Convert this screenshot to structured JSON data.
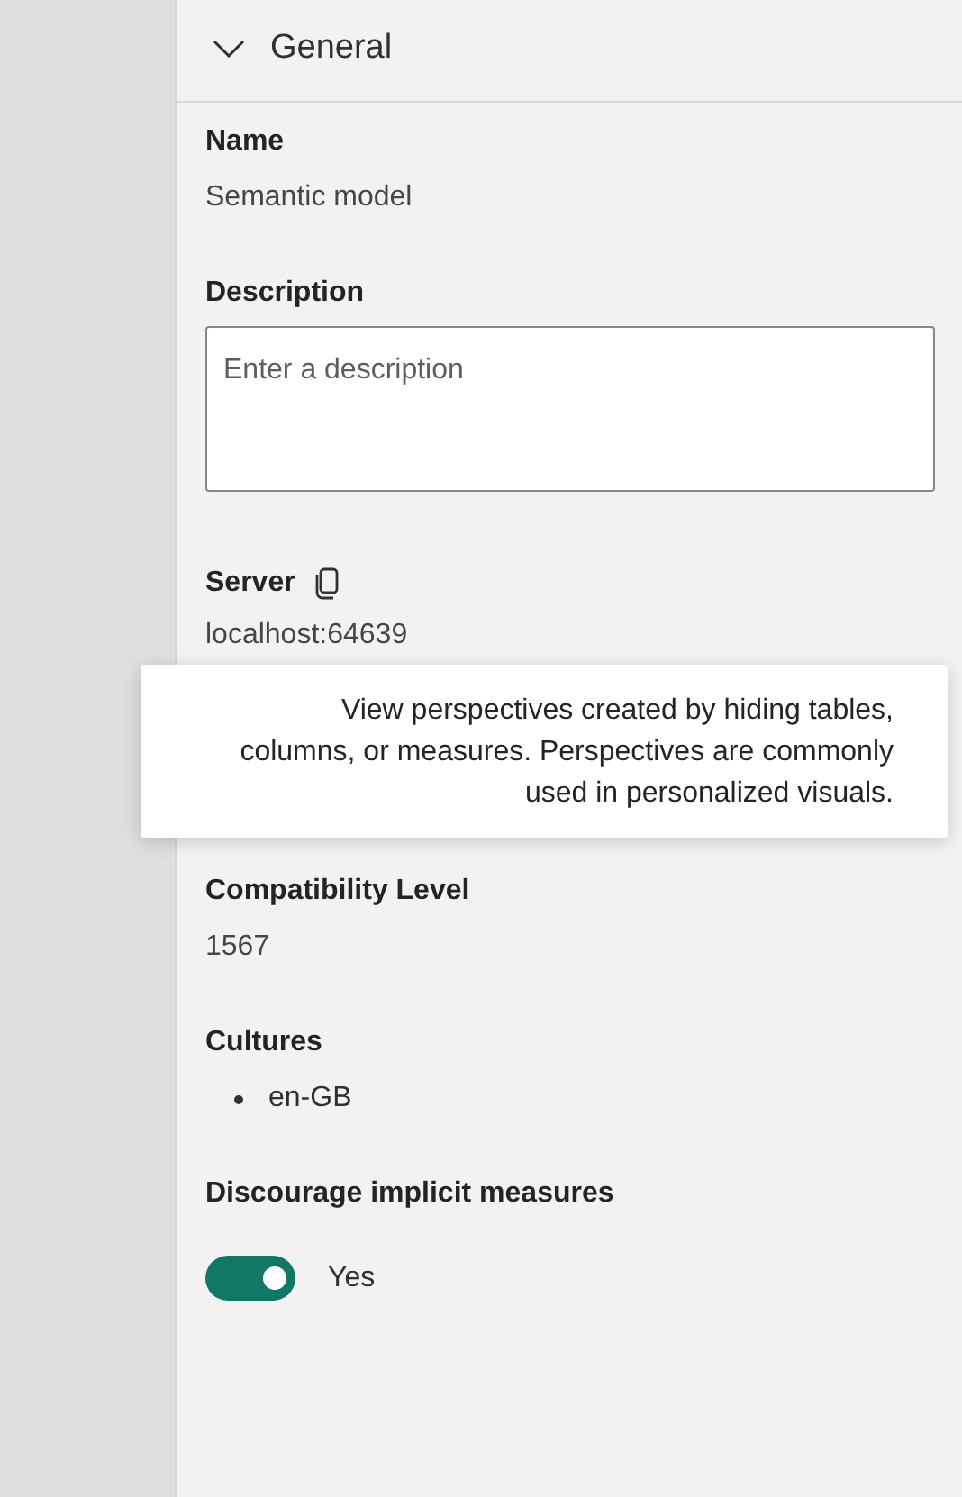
{
  "section": {
    "title": "General",
    "expanded": true
  },
  "name": {
    "label": "Name",
    "value": "Semantic model"
  },
  "description": {
    "label": "Description",
    "placeholder": "Enter a description"
  },
  "server": {
    "label": "Server",
    "value": "localhost:64639"
  },
  "tooltip": {
    "text": "View perspectives created by hiding tables, columns, or measures. Perspectives are commonly used in personalized visuals."
  },
  "compatibility": {
    "label": "Compatibility Level",
    "value": "1567"
  },
  "cultures": {
    "label": "Cultures",
    "items": [
      "en-GB"
    ]
  },
  "implicit_measures": {
    "label": "Discourage implicit measures",
    "on": true,
    "state_label": "Yes"
  }
}
